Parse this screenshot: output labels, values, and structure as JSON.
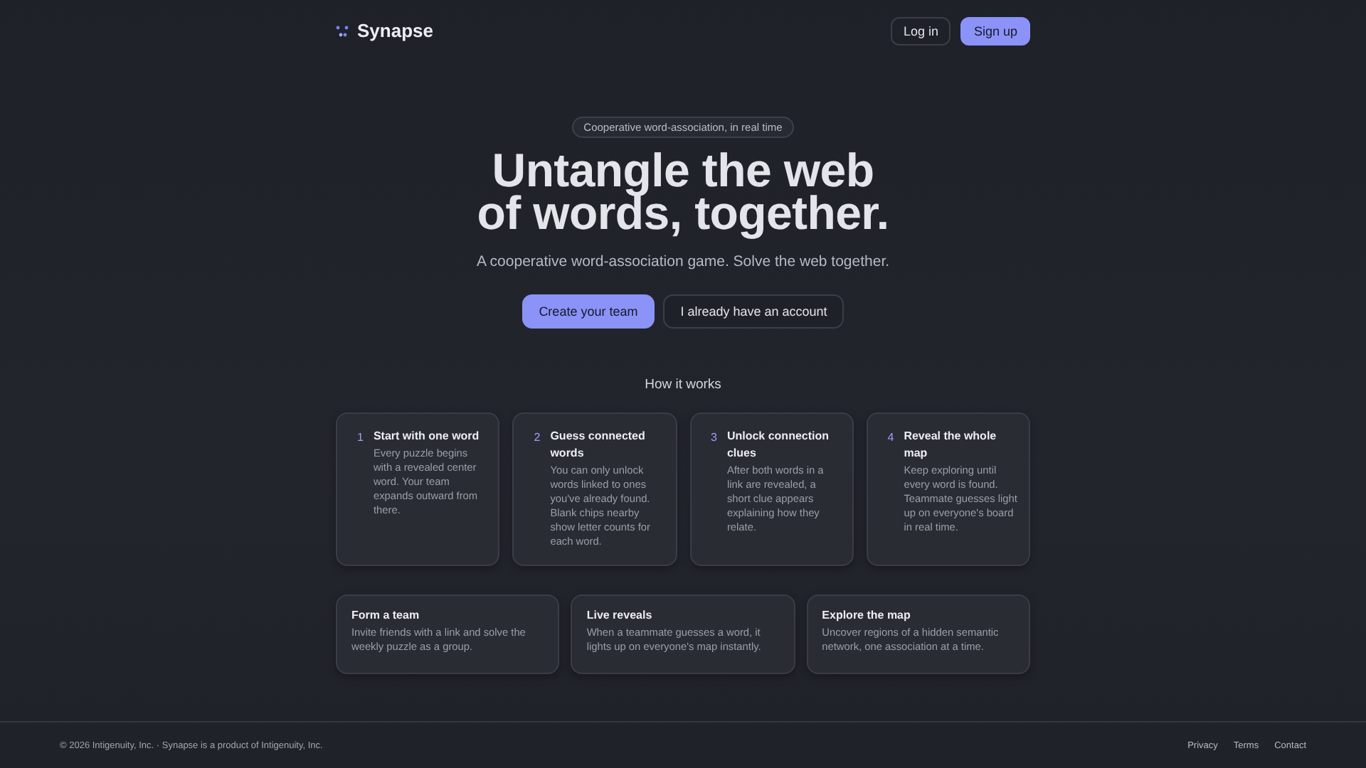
{
  "header": {
    "brand": "Synapse",
    "actions": [
      {
        "label": "Log in",
        "kind": "secondary"
      },
      {
        "label": "Sign up",
        "kind": "primary"
      }
    ]
  },
  "hero": {
    "badge": "Cooperative word-association, in real time",
    "title_lines": [
      "Untangle the web",
      "of words, together."
    ],
    "subtitle": "A cooperative word-association game. Solve the web together.",
    "actions": [
      {
        "label": "Create your team",
        "kind": "primary"
      },
      {
        "label": "I already have an account",
        "kind": "secondary"
      }
    ]
  },
  "how_it_works": {
    "heading": "How it works",
    "steps": [
      {
        "number": "1",
        "title": "Start with one word",
        "text": "Every puzzle begins with a revealed center word. Your team expands outward from there."
      },
      {
        "number": "2",
        "title": "Guess connected words",
        "text": "You can only unlock words linked to ones you've already found. Blank chips nearby show letter counts for each word."
      },
      {
        "number": "3",
        "title": "Unlock connection clues",
        "text": "After both words in a link are revealed, a short clue appears explaining how they relate."
      },
      {
        "number": "4",
        "title": "Reveal the whole map",
        "text": "Keep exploring until every word is found. Teammate guesses light up on everyone's board in real time."
      }
    ]
  },
  "features": [
    {
      "title": "Form a team",
      "text": "Invite friends with a link and solve the weekly puzzle as a group."
    },
    {
      "title": "Live reveals",
      "text": "When a teammate guesses a word, it lights up on everyone's map instantly."
    },
    {
      "title": "Explore the map",
      "text": "Uncover regions of a hidden semantic network, one association at a time."
    }
  ],
  "footer": {
    "copyright": "© 2026 Intigenuity, Inc. · Synapse is a product of Intigenuity, Inc.",
    "links": [
      "Privacy",
      "Terms",
      "Contact"
    ]
  }
}
